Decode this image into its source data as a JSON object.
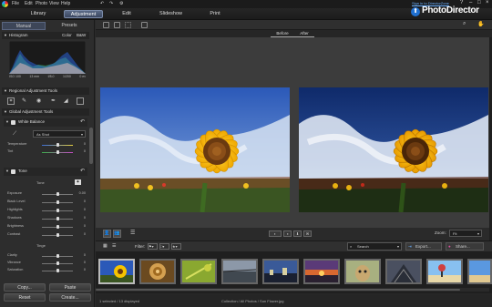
{
  "menu": {
    "items": [
      "File",
      "Edit",
      "Photo",
      "View",
      "Help"
    ]
  },
  "nav": {
    "tabs": [
      "Library",
      "Adjustment",
      "Edit",
      "Slideshow",
      "Print"
    ],
    "active": "Adjustment",
    "signin": "Sign in to DirectorZone",
    "brand": "PhotoDirector"
  },
  "panel": {
    "tabs": [
      "Manual",
      "Presets"
    ],
    "histogram": {
      "title": "Histogram",
      "color_label": "Color",
      "bw_label": "B&W",
      "exif": [
        "ISO 100",
        "13 mm",
        "f/8.0",
        "1/200",
        "0 ev"
      ]
    },
    "regional_title": "Regional Adjustment Tools",
    "global_title": "Global Adjustment Tools",
    "white_balance": {
      "title": "White Balance",
      "preset": "As Shot",
      "temperature_label": "Temperature",
      "temperature_value": "0",
      "tint_label": "Tint",
      "tint_value": "0"
    },
    "tone": {
      "title": "Tone",
      "subtitle": "Tone",
      "rows": [
        {
          "label": "Exposure",
          "value": "0.00"
        },
        {
          "label": "Black Level",
          "value": "0"
        },
        {
          "label": "Highlights",
          "value": "0"
        },
        {
          "label": "Shadows",
          "value": "0"
        },
        {
          "label": "Brightness",
          "value": "0"
        },
        {
          "label": "Contrast",
          "value": "0"
        }
      ]
    },
    "tinge": {
      "subtitle": "Tinge",
      "rows": [
        {
          "label": "Clarity",
          "value": "0"
        },
        {
          "label": "Vibrance",
          "value": "0"
        },
        {
          "label": "Saturation",
          "value": "0"
        }
      ]
    },
    "buttons": {
      "copy": "Copy...",
      "paste": "Paste",
      "reset": "Reset",
      "create": "Create..."
    }
  },
  "main": {
    "before": "Before",
    "after": "After",
    "zoom_label": "Zoom:",
    "zoom_value": "Fit",
    "filter_label": "Filter:",
    "search_placeholder": "Search",
    "export_label": "Export...",
    "share_label": "Share...",
    "status_left": "1 selected / 13 displayed",
    "status_center": "Collection / All Photos / Sun Flower.jpg"
  },
  "colors": {
    "accent": "#3d4658",
    "link": "#6ab0ff",
    "sky": "#2f5aa8",
    "sunflower": "#f6c400"
  }
}
